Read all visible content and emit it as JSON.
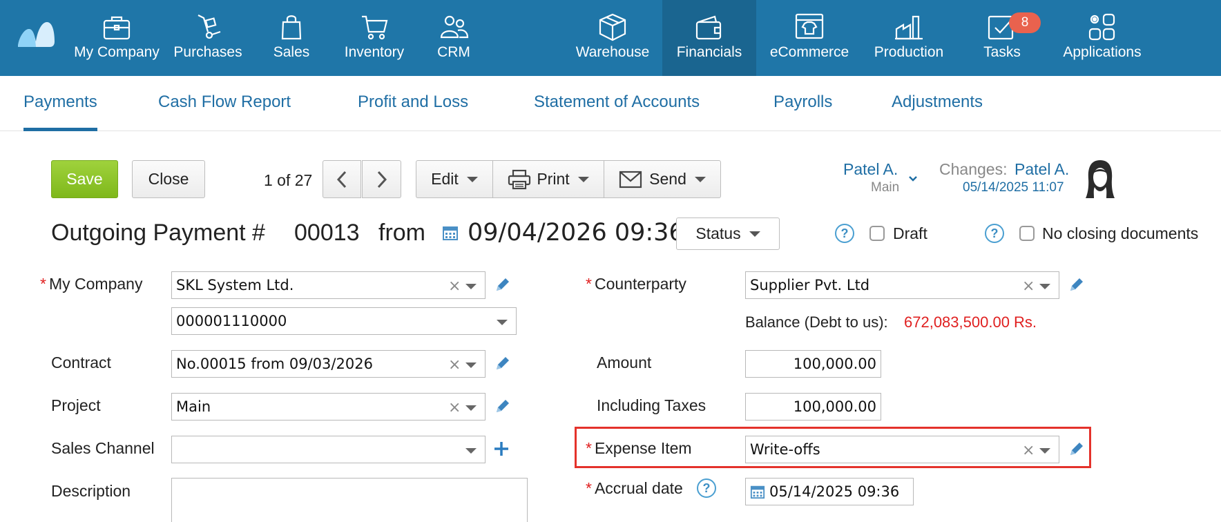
{
  "nav": {
    "items": [
      {
        "label": "My Company",
        "icon": "briefcase-icon"
      },
      {
        "label": "Purchases",
        "icon": "hand-truck-icon"
      },
      {
        "label": "Sales",
        "icon": "shopping-bag-icon"
      },
      {
        "label": "Inventory",
        "icon": "cart-icon"
      },
      {
        "label": "CRM",
        "icon": "people-icon"
      },
      {
        "label": "Warehouse",
        "icon": "box-icon"
      },
      {
        "label": "Financials",
        "icon": "wallet-icon"
      },
      {
        "label": "eCommerce",
        "icon": "shop-icon"
      },
      {
        "label": "Production",
        "icon": "factory-icon"
      },
      {
        "label": "Tasks",
        "icon": "tasks-icon"
      },
      {
        "label": "Applications",
        "icon": "apps-icon"
      }
    ],
    "active": "Financials",
    "tasks_badge": "8"
  },
  "subtabs": {
    "items": [
      "Payments",
      "Cash Flow Report",
      "Profit and Loss",
      "Statement of Accounts",
      "Payrolls",
      "Adjustments"
    ],
    "active": "Payments"
  },
  "toolbar": {
    "save_label": "Save",
    "close_label": "Close",
    "pager": "1 of 27",
    "edit_label": "Edit",
    "print_label": "Print",
    "send_label": "Send"
  },
  "user": {
    "name": "Patel A.",
    "role": "Main",
    "changes_label": "Changes:",
    "changes_user": "Patel A.",
    "changes_date": "05/14/2025 11:07"
  },
  "document": {
    "title": "Outgoing Payment #",
    "number": "00013",
    "from_label": "from",
    "datetime": "09/04/2026 09:36",
    "status_label": "Status",
    "draft_label": "Draft",
    "no_closing_label": "No closing documents"
  },
  "form": {
    "my_company": {
      "label": "My Company",
      "value": "SKL System Ltd.",
      "account": "000001110000"
    },
    "contract": {
      "label": "Contract",
      "value": "No.00015 from 09/03/2026"
    },
    "project": {
      "label": "Project",
      "value": "Main"
    },
    "sales_channel": {
      "label": "Sales Channel",
      "value": ""
    },
    "description": {
      "label": "Description",
      "value": ""
    },
    "counterparty": {
      "label": "Counterparty",
      "value": "Supplier Pvt. Ltd"
    },
    "balance": {
      "label": "Balance (Debt to us):",
      "value": "672,083,500.00 Rs."
    },
    "amount": {
      "label": "Amount",
      "value": "100,000.00"
    },
    "including_taxes": {
      "label": "Including Taxes",
      "value": "100,000.00"
    },
    "expense_item": {
      "label": "Expense Item",
      "value": "Write-offs"
    },
    "accrual_date": {
      "label": "Accrual date",
      "value": "05/14/2025 09:36"
    }
  },
  "colors": {
    "nav_bg": "#1f76a8",
    "nav_active_bg": "#1a6590",
    "link": "#1f6ea4",
    "save_green": "#8cc42a",
    "balance_red": "#e02020",
    "highlight_red": "#e4322b"
  }
}
